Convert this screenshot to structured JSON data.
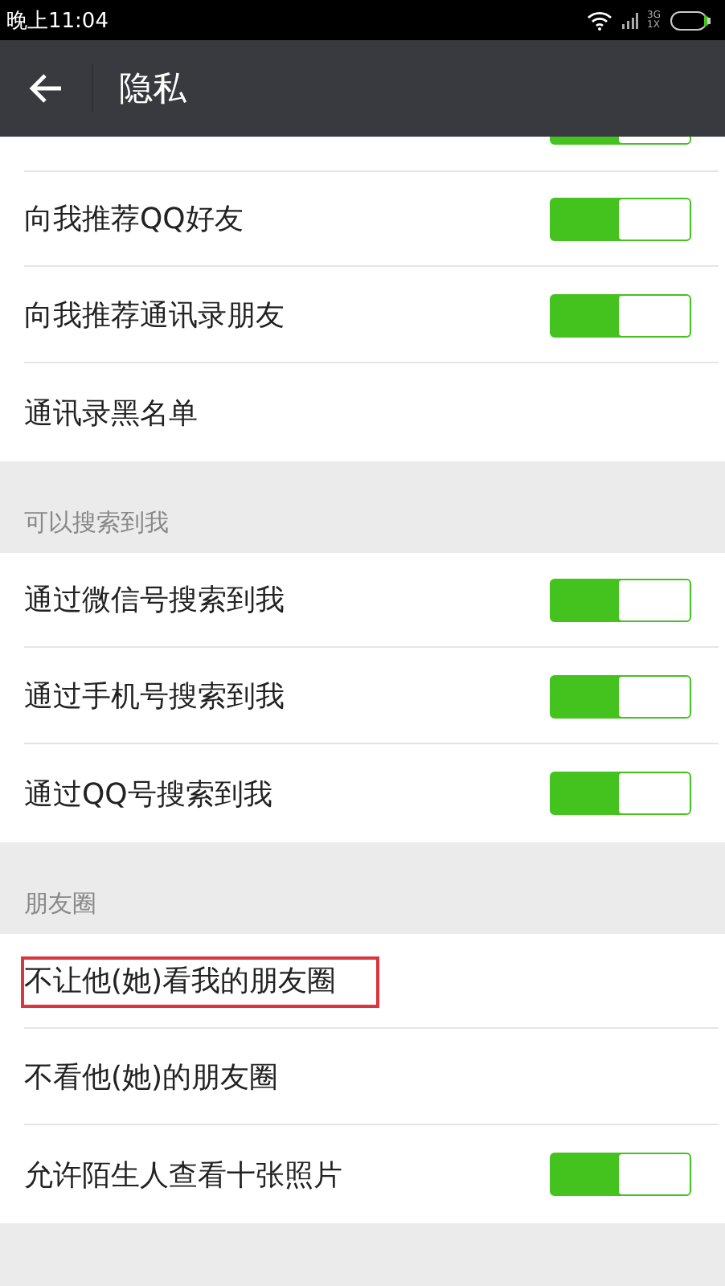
{
  "status_bar": {
    "time": "晚上11:04",
    "network": "3G",
    "network_sub": "1X"
  },
  "header": {
    "title": "隐私"
  },
  "sections": [
    {
      "items": [
        {
          "kind": "toggle",
          "on": true,
          "partial": true
        },
        {
          "kind": "toggle",
          "label": "向我推荐QQ好友",
          "on": true
        },
        {
          "kind": "toggle",
          "label": "向我推荐通讯录朋友",
          "on": true
        },
        {
          "kind": "link",
          "label": "通讯录黑名单"
        }
      ]
    },
    {
      "title": "可以搜索到我",
      "items": [
        {
          "kind": "toggle",
          "label": "通过微信号搜索到我",
          "on": true
        },
        {
          "kind": "toggle",
          "label": "通过手机号搜索到我",
          "on": true
        },
        {
          "kind": "toggle",
          "label": "通过QQ号搜索到我",
          "on": true
        }
      ]
    },
    {
      "title": "朋友圈",
      "items": [
        {
          "kind": "link",
          "label": "不让他(她)看我的朋友圈",
          "highlighted": true
        },
        {
          "kind": "link",
          "label": "不看他(她)的朋友圈"
        },
        {
          "kind": "toggle",
          "label": "允许陌生人查看十张照片",
          "on": true
        }
      ]
    }
  ]
}
